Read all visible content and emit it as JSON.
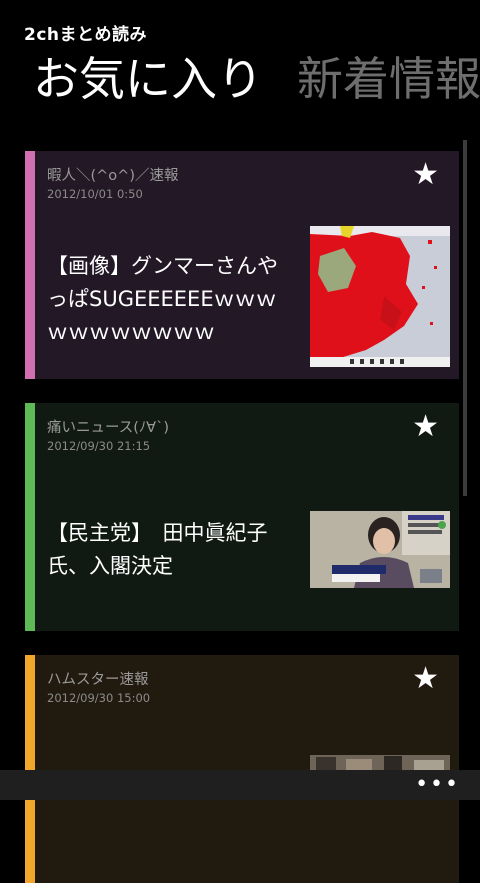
{
  "app": {
    "title": "2chまとめ読み"
  },
  "pivot": {
    "active": "お気に入り",
    "next": "新着情報"
  },
  "articles": [
    {
      "source": "暇人＼(^o^)／速報",
      "date": "2012/10/01 0:50",
      "headline": "【画像】グンマーさんやっぱSUGEEEEEEｗｗｗｗｗｗｗｗｗｗｗ",
      "accent": "#d16fb2",
      "background": "#231826",
      "thumb_icon": "map-thumbnail"
    },
    {
      "source": "痛いニュース(ﾉ∀`)",
      "date": "2012/09/30 21:15",
      "headline": "【民主党】　田中眞紀子氏、入閣決定",
      "accent": "#5dba55",
      "background": "#111a12",
      "thumb_icon": "person-photo-thumbnail"
    },
    {
      "source": "ハムスター速報",
      "date": "2012/09/30 15:00",
      "headline": "",
      "accent": "#f0a72c",
      "background": "#211a0f",
      "thumb_icon": "photo-thumbnail"
    }
  ],
  "appbar": {
    "more": "•••"
  },
  "icons": {
    "favorite": "★"
  }
}
